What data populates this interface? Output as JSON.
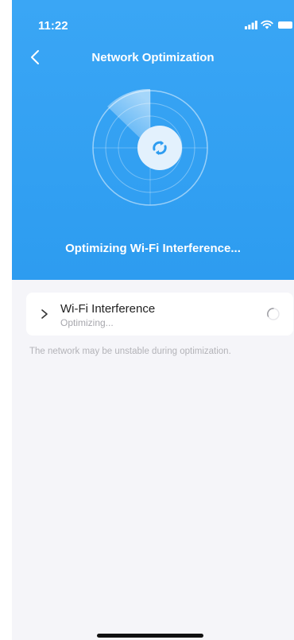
{
  "status_bar": {
    "time": "11:22",
    "icons": [
      "signal-icon",
      "wifi-icon",
      "battery-icon"
    ]
  },
  "nav": {
    "title": "Network Optimization",
    "back_icon": "chevron-left-icon"
  },
  "hero": {
    "status_text": "Optimizing Wi-Fi Interference...",
    "center_icon": "refresh-arrows-icon",
    "background_color": "#2d9cf0"
  },
  "tasks": [
    {
      "title": "Wi-Fi Interference",
      "status": "Optimizing...",
      "icon": "chevron-right-icon",
      "indicator": "spinner-icon"
    }
  ],
  "note": "The network may be unstable during optimization.",
  "colors": {
    "accent": "#2d9cf0",
    "page_background": "#f5f5f9",
    "card_background": "#ffffff",
    "muted_text": "#a7a7ad"
  }
}
